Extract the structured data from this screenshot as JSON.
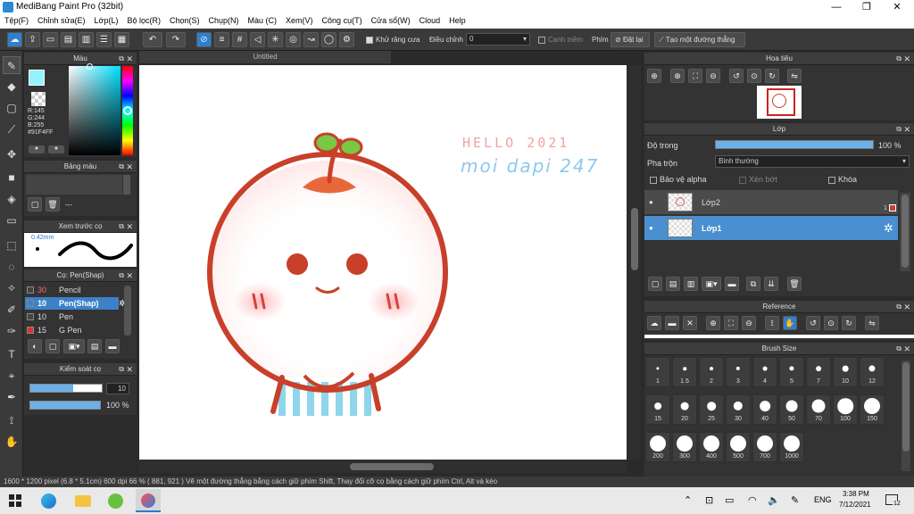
{
  "window": {
    "title": "MediBang Paint Pro (32bit)",
    "minimize": "—",
    "maximize": "❐",
    "close": "✕"
  },
  "menu": [
    "Tệp(F)",
    "Chỉnh sửa(E)",
    "Lớp(L)",
    "Bộ lọc(R)",
    "Chọn(S)",
    "Chụp(N)",
    "Màu (C)",
    "Xem(V)",
    "Công cụ(T)",
    "Cửa sổ(W)",
    "Cloud",
    "Help"
  ],
  "toolbar": {
    "antialias_label": "Khử răng cưa",
    "adjust_label": "Điều chỉnh",
    "adjust_value": "0",
    "edge_label": "Cạnh mềm",
    "key_label": "Phím",
    "reset_label": "Đặt lại",
    "new_line_label": "Tạo một đường thẳng"
  },
  "color_panel": {
    "title": "Màu",
    "r": "R:145",
    "g": "G:244",
    "b": "B:255",
    "hex": "#91F4FF",
    "fg_color": "#91F4FF"
  },
  "palette_panel": {
    "title": "Bảng màu",
    "dash": "---"
  },
  "brush_preview": {
    "title": "Xem trước cọ",
    "size": "0.42mm"
  },
  "brush_panel": {
    "title": "Cọ: Pen(Shap)",
    "items": [
      {
        "size": "30",
        "name": "Pencil",
        "color": "#ff6666",
        "swatch": "#444444"
      },
      {
        "size": "10",
        "name": "Pen(Shap)",
        "color": "#ffffff",
        "swatch": "#3d80c8"
      },
      {
        "size": "10",
        "name": "Pen",
        "color": "#dddddd",
        "swatch": "#444444"
      },
      {
        "size": "15",
        "name": "G Pen",
        "color": "#dddddd",
        "swatch": "#e03030"
      }
    ]
  },
  "control_panel": {
    "title": "Kiểm soát cọ",
    "size_value": "10",
    "opacity_value": "100 %",
    "size_fill": 0.6,
    "opacity_fill": 1.0
  },
  "canvas": {
    "tab": "Untitled",
    "text_line1": "HELLO 2021",
    "text_line2": "moi dapi 247",
    "text1_color": "#f4a0a0",
    "text2_color": "#8cc8f0"
  },
  "status": {
    "size": "1600 * 1200 pixel",
    "cm": "(6.8 * 5.1cm)",
    "dpi": "600 dpi",
    "zoom": "66 %",
    "coords": "( 881, 921 )",
    "hint": "Vẽ một đường thẳng bằng cách giữ phím Shift, Thay đổi cỡ cọ bằng cách giữ phím Ctrl, Alt và kéo"
  },
  "navigator": {
    "title": "Hoa tiêu"
  },
  "layers_panel": {
    "title": "Lớp",
    "opacity_label": "Độ trong",
    "opacity_value": "100 %",
    "opacity_fill": 1.0,
    "blend_label": "Pha trộn",
    "blend_value": "Bình thường",
    "protect_alpha": "Bảo vệ alpha",
    "clipping": "Xén bớt",
    "lock": "Khóa",
    "layers": [
      {
        "name": "Lớp2",
        "badge": "1"
      },
      {
        "name": "Lớp1"
      }
    ]
  },
  "reference": {
    "title": "Reference"
  },
  "brush_size": {
    "title": "Brush Size",
    "sizes": [
      "1",
      "1.5",
      "2",
      "3",
      "4",
      "5",
      "7",
      "10",
      "12",
      "15",
      "20",
      "25",
      "30",
      "40",
      "50",
      "70",
      "100",
      "150",
      "200",
      "300",
      "400",
      "500",
      "700",
      "1000"
    ]
  },
  "taskbar": {
    "lang": "ENG",
    "time": "3:38 PM",
    "date": "7/12/2021",
    "notif": "12"
  }
}
